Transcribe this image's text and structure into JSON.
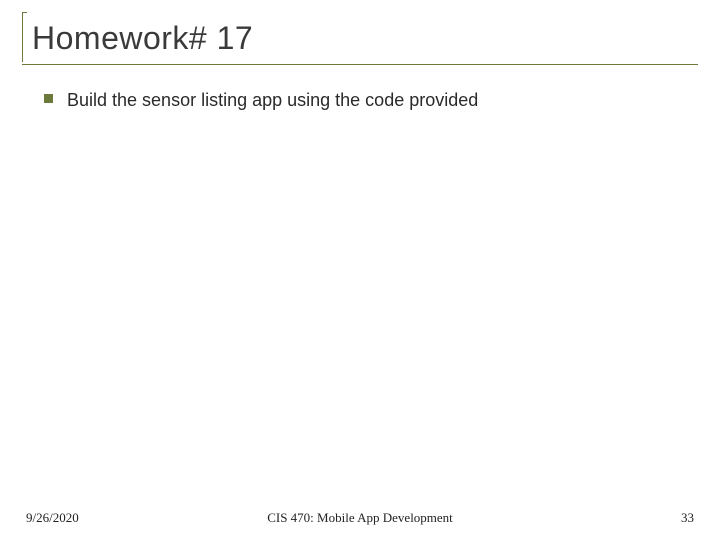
{
  "slide": {
    "title": "Homework# 17",
    "bullets": [
      {
        "text": "Build the sensor listing app using the code provided"
      }
    ]
  },
  "footer": {
    "date": "9/26/2020",
    "course": "CIS 470: Mobile App Development",
    "page": "33"
  },
  "colors": {
    "accent": "#6b7a3a"
  }
}
